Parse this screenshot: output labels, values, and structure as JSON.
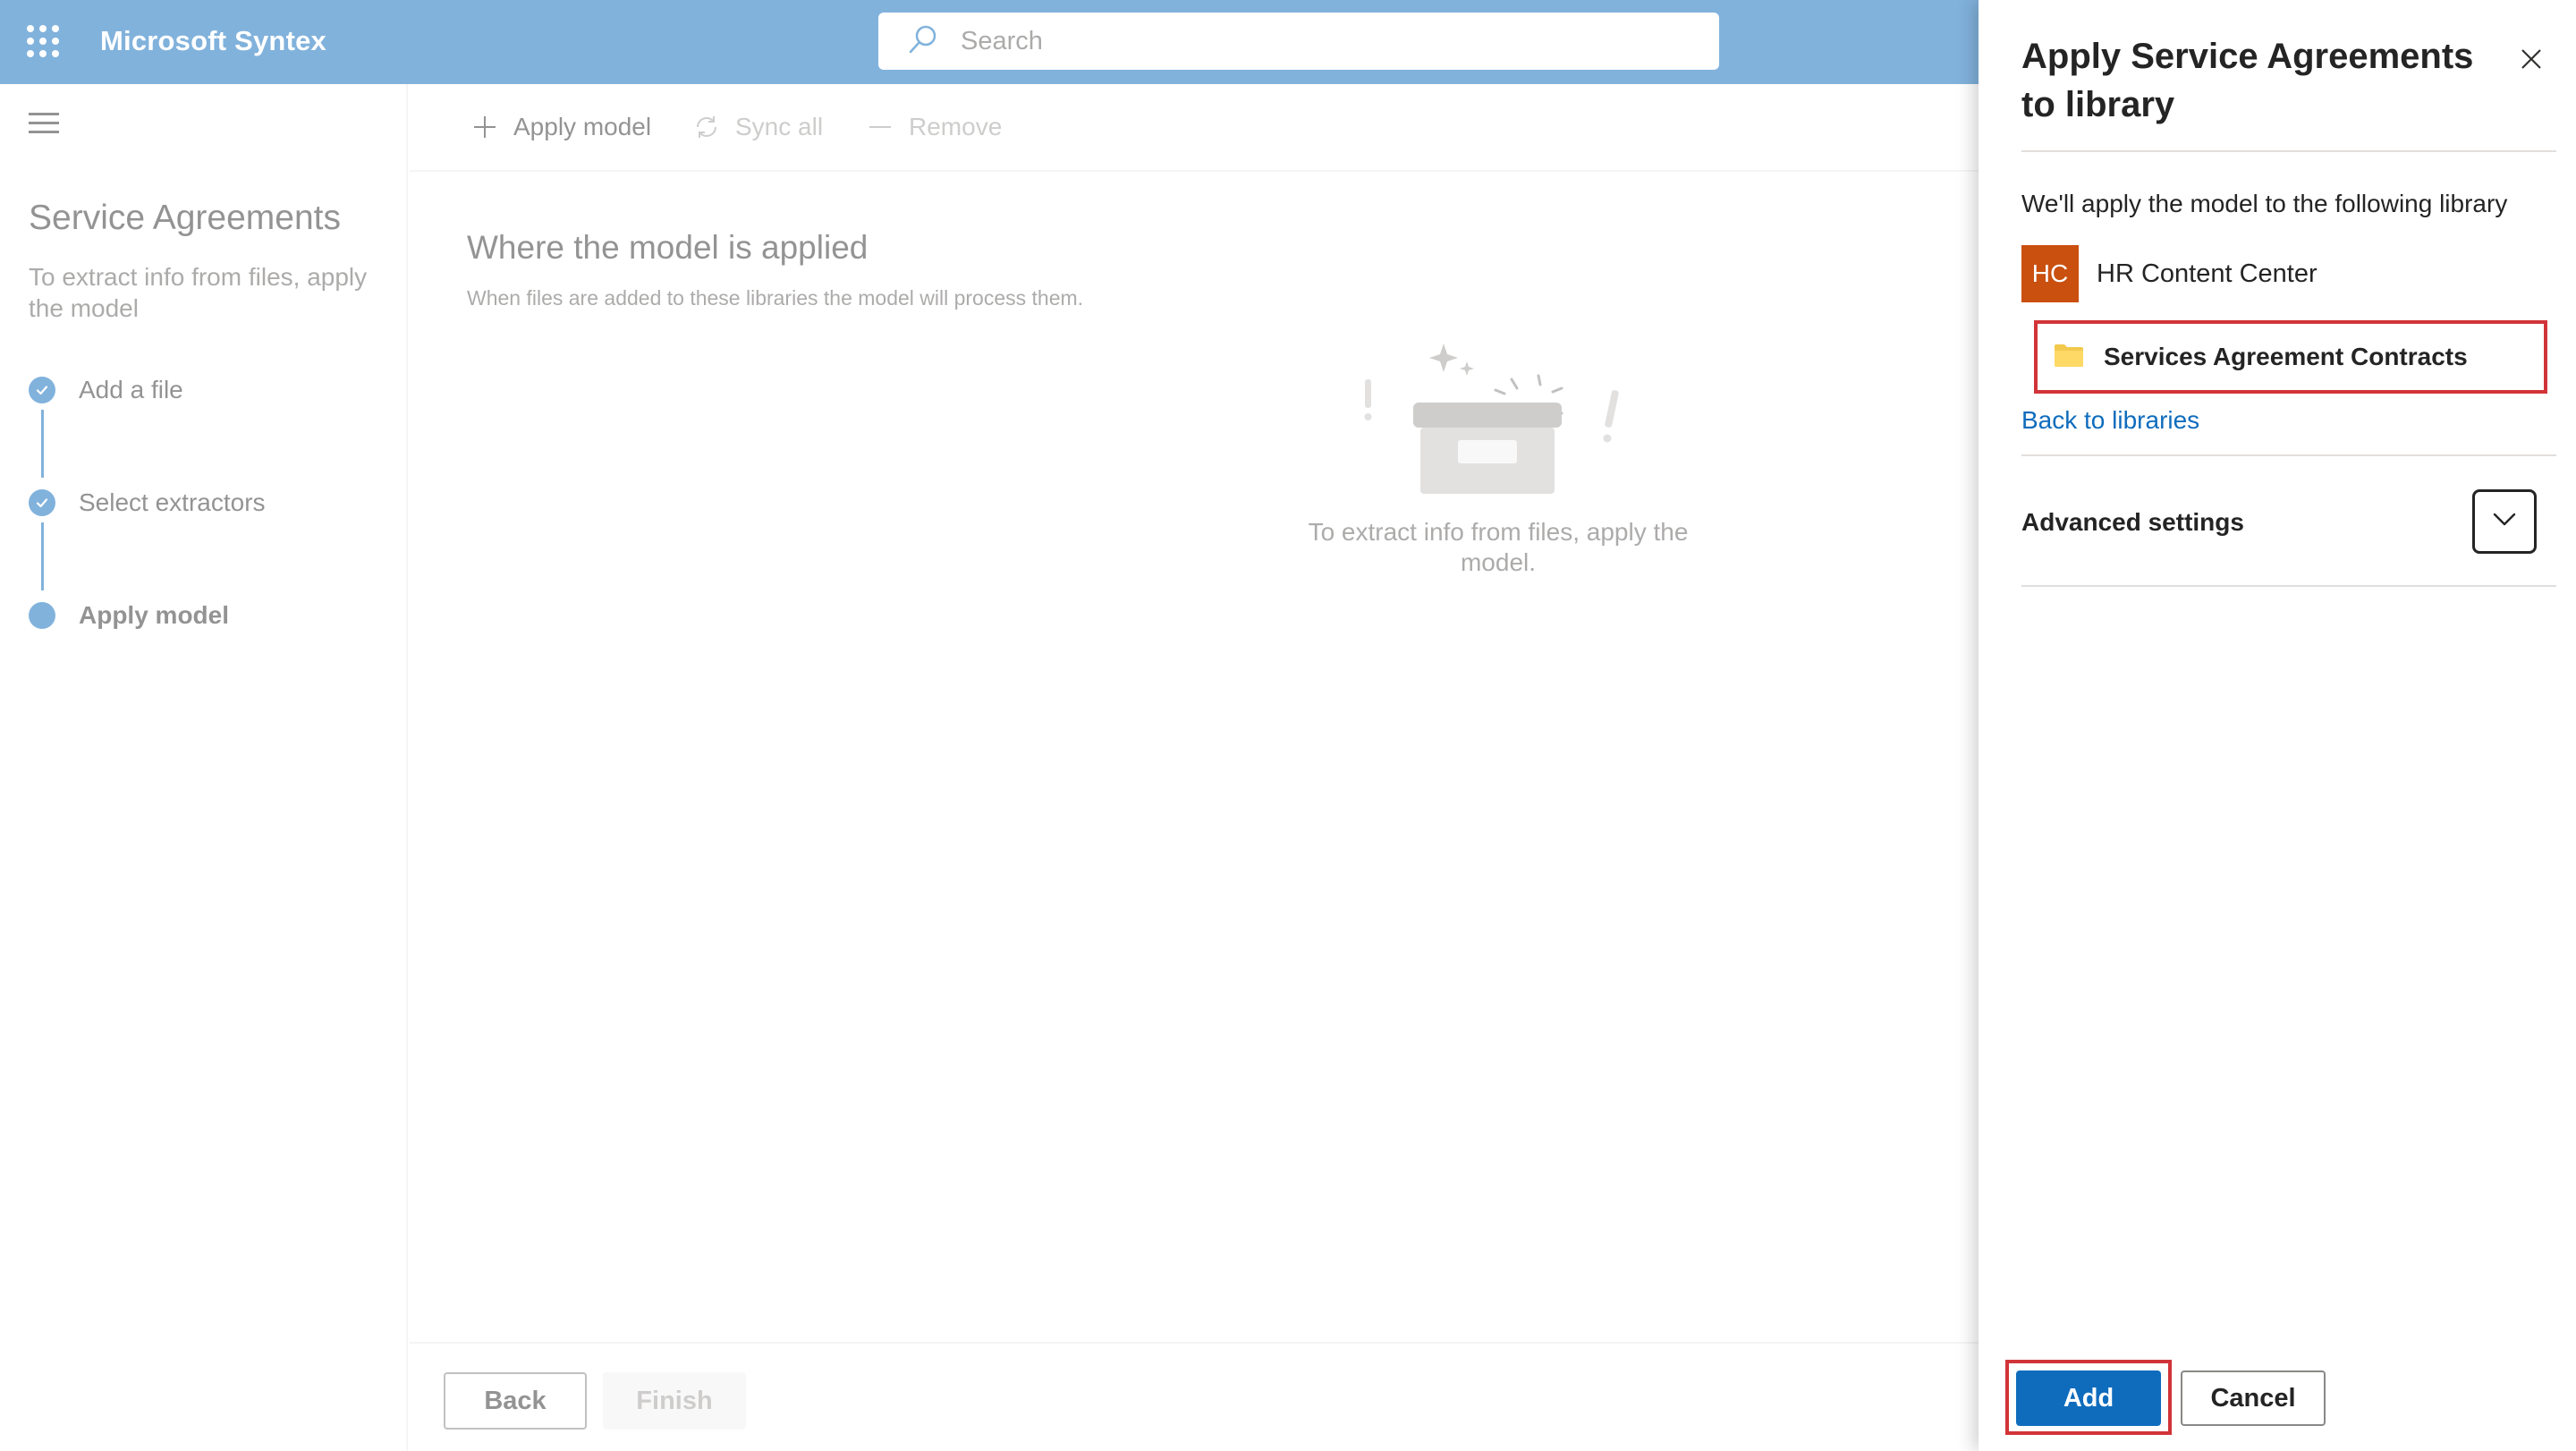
{
  "app": {
    "title": "Microsoft Syntex",
    "search_placeholder": "Search",
    "icons": {
      "app_launcher": "waffle-icon",
      "search": "search-icon"
    }
  },
  "leftnav": {
    "menu_icon": "hamburger-icon",
    "title": "Service Agreements",
    "subtitle": "To extract info from files, apply the model",
    "steps": [
      {
        "label": "Add a file",
        "state": "complete"
      },
      {
        "label": "Select extractors",
        "state": "complete"
      },
      {
        "label": "Apply model",
        "state": "current"
      }
    ]
  },
  "commandbar": {
    "apply_model": "Apply model",
    "sync_all": "Sync all",
    "remove": "Remove"
  },
  "main": {
    "title": "Where the model is applied",
    "subtitle": "When files are added to these libraries the model will process them.",
    "empty_state": "To extract info from files, apply the model.",
    "back_button": "Back",
    "finish_button": "Finish"
  },
  "panel": {
    "title": "Apply Service Agreements to library",
    "intro": "We'll apply the model to the following library",
    "site": {
      "initials": "HC",
      "name": "HR Content Center",
      "color": "#ca5010"
    },
    "library": {
      "name": "Services Agreement Contracts",
      "icon": "folder-icon"
    },
    "back_link": "Back to libraries",
    "advanced_settings": "Advanced settings",
    "add_button": "Add",
    "cancel_button": "Cancel"
  },
  "colors": {
    "brand": "#0f6cbd",
    "highlight": "#d13438"
  }
}
